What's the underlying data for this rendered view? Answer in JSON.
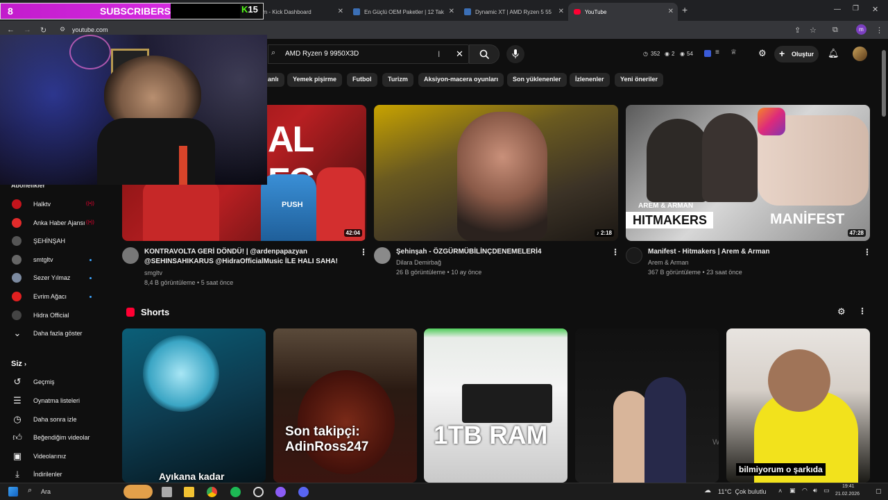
{
  "browser": {
    "tabs": [
      {
        "label": "am - Kick Dashboard",
        "active": false
      },
      {
        "label": "En Güçlü OEM Paketler | 12 Tak",
        "active": false
      },
      {
        "label": "Dynamic XT | AMD Ryzen 5 55",
        "active": false
      },
      {
        "label": "YouTube",
        "active": true
      }
    ],
    "url": "youtube.com",
    "new_tab": "+",
    "close_glyph": "✕"
  },
  "overlay": {
    "sub_count": "8",
    "sub_label": "SUBSCRIBERS",
    "kick_count": "15",
    "kick_glyph": "K"
  },
  "header": {
    "search_value": "AMD Ryzen 9 9950X3D",
    "stats": [
      "352",
      "2",
      "54"
    ],
    "create_label": "Oluştur"
  },
  "chips": [
    "anlı",
    "Yemek pişirme",
    "Futbol",
    "Turizm",
    "Aksiyon-macera oyunları",
    "Son yüklenenler",
    "İzlenenler",
    "Yeni öneriler"
  ],
  "sidebar": {
    "subs_heading": "Abonelikler",
    "subscriptions": [
      {
        "label": "Halktv",
        "live": true
      },
      {
        "label": "Anka Haber Ajansı",
        "live": true
      },
      {
        "label": "ŞEHİNŞAH",
        "live": false
      },
      {
        "label": "smtgltv",
        "live": false,
        "new": true
      },
      {
        "label": "Sezer Yılmaz",
        "live": false,
        "new": true
      },
      {
        "label": "Evrim Ağacı",
        "live": false,
        "new": true
      },
      {
        "label": "Hidra Official",
        "live": false
      },
      {
        "label": "Daha fazla göster",
        "live": false
      }
    ],
    "you_heading": "Siz",
    "you_items": [
      "Geçmiş",
      "Oynatma listeleri",
      "Daha sonra izle",
      "Beğendiğim videolar",
      "Videolarınız",
      "İndirilenler"
    ]
  },
  "videos": [
    {
      "title_line1": "KONTRAVOLTA GERİ DÖNDÜ! | @ardenpapazyan",
      "title_line2": "@SEHINSAHIKARUS @HidraOfficialMusic İLE HALI SAHA!",
      "channel": "smgltv",
      "meta": "8,4 B görüntüleme • 5 saat önce",
      "duration": "42:04",
      "thumb_text": "AL FC",
      "thumb_jersey": "PUSH"
    },
    {
      "title_line1": "Şehinşah - ÖZGÜRMÜBİLİNÇDENEMELERİ4",
      "title_line2": "",
      "channel": "Dilara Demirbağ",
      "meta": "26 B görüntüleme • 10 ay önce",
      "duration": "2:18"
    },
    {
      "title_line1": "Manifest - Hitmakers | Arem & Arman",
      "title_line2": "",
      "channel": "Arem & Arman",
      "meta": "367 B görüntüleme • 23 saat önce",
      "duration": "47:28",
      "thumb_small": "AREM & ARMAN",
      "thumb_hit": "HITMAKERS",
      "thumb_man": "MANİFEST"
    }
  ],
  "shorts": {
    "heading": "Shorts",
    "captions": [
      "Ayıkana kadar",
      "Son takipçi: AdinRoss247",
      "1TB RAM",
      "",
      "bilmiyorum o şarkıda"
    ],
    "watermark": "Windows'u Etkinleştir"
  },
  "taskbar": {
    "search_label": "Ara",
    "weather": "11°C  Çok bulutlu",
    "time": "19:41",
    "date": "21.02.2026"
  },
  "colors": {
    "bg": "#0f0f0f",
    "accent_red": "#ff0033",
    "overlay_pink": "#d52ae0",
    "kick_green": "#53fc18"
  }
}
